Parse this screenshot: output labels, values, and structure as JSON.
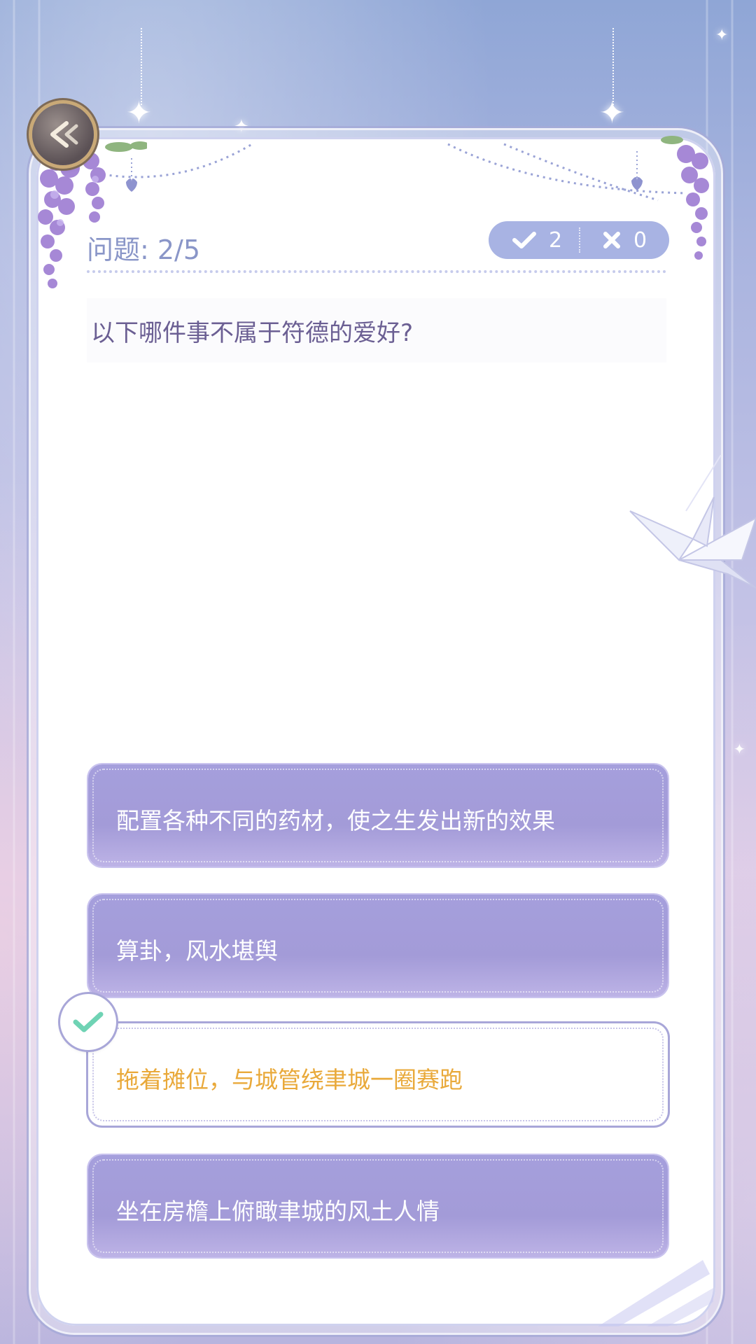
{
  "quiz": {
    "progress": "问题: 2/5",
    "correct_count": "2",
    "wrong_count": "0",
    "question": "以下哪件事不属于符德的爱好?",
    "options": [
      {
        "label": "配置各种不同的药材，使之生发出新的效果",
        "state": "default"
      },
      {
        "label": "算卦，风水堪舆",
        "state": "default"
      },
      {
        "label": "拖着摊位，与城管绕聿城一圈赛跑",
        "state": "correct"
      },
      {
        "label": "坐在房檐上俯瞰聿城的风土人情",
        "state": "default"
      }
    ]
  },
  "colors": {
    "option_bg": "#a59fdc",
    "correct_text": "#e9a93a",
    "check_green": "#6fd3b4",
    "score_pill": "#a8b3e3",
    "question_text": "#6b5f93"
  },
  "icons": {
    "back": "back-arrow-icon",
    "correct": "checkmark-icon",
    "wrong": "cross-icon"
  }
}
